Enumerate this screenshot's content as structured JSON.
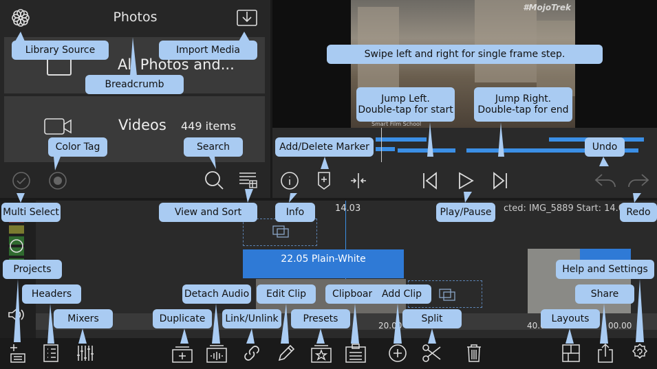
{
  "library": {
    "title": "Photos",
    "rows": [
      {
        "label": "All Photos and...",
        "count": ""
      },
      {
        "label": "Videos",
        "count": "449 items"
      }
    ]
  },
  "viewer": {
    "watermark": "#MojoTrek",
    "watermark2": "Smart Film School"
  },
  "timeline": {
    "timecode": "14.03",
    "status": "cted: IMG_5889 Start: 14.03 Duratio",
    "clip_label": "22.05  Plain-White",
    "ruler": [
      "20.00",
      "40.00",
      "00.00"
    ]
  },
  "callouts": {
    "library_source": "Library Source",
    "import_media": "Import Media",
    "breadcrumb": "Breadcrumb",
    "swipe": "Swipe left and right for single frame step.",
    "jump_left_1": "Jump Left.",
    "jump_left_2": "Double-tap for start",
    "jump_right_1": "Jump Right.",
    "jump_right_2": "Double-tap for end",
    "color_tag": "Color Tag",
    "search": "Search",
    "add_marker": "Add/Delete Marker",
    "undo": "Undo",
    "multi_select": "Multi Select",
    "view_sort": "View and Sort",
    "info": "Info",
    "play_pause": "Play/Pause",
    "redo": "Redo",
    "projects": "Projects",
    "help_settings": "Help and Settings",
    "headers": "Headers",
    "detach_audio": "Detach Audio",
    "edit_clip": "Edit Clip",
    "clipboard": "Clipboard",
    "add_clip": "Add Clip",
    "share": "Share",
    "mixers": "Mixers",
    "duplicate": "Duplicate",
    "link_unlink": "Link/Unlink",
    "presets": "Presets",
    "split": "Split",
    "layouts": "Layouts"
  },
  "colors": {
    "accent": "#3b8fe6",
    "callout": "#a9cbf2",
    "panel": "#2a2a2a"
  }
}
